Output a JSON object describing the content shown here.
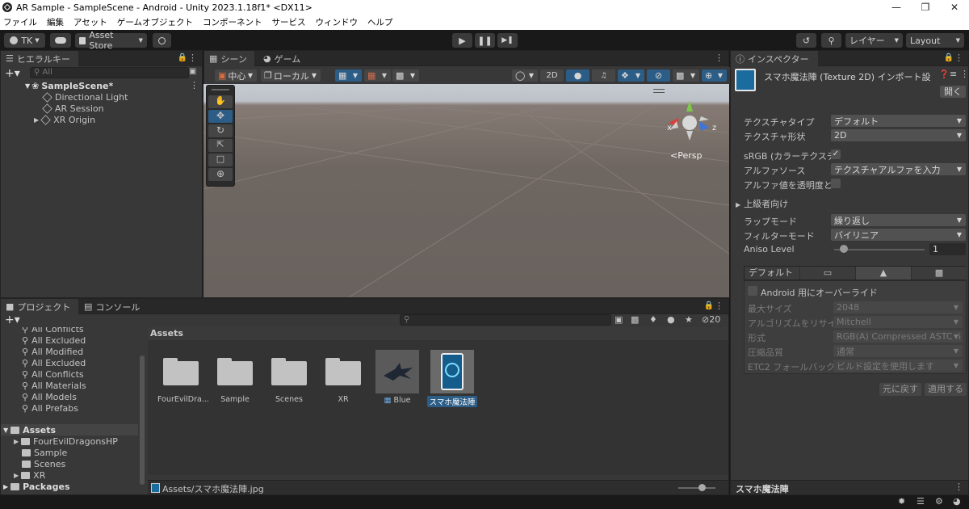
{
  "window": {
    "title": "AR Sample - SampleScene - Android - Unity 2023.1.18f1* <DX11>"
  },
  "menu": [
    "ファイル",
    "編集",
    "アセット",
    "ゲームオブジェクト",
    "コンポーネント",
    "サービス",
    "ウィンドウ",
    "ヘルプ"
  ],
  "toolbar": {
    "account": "TK",
    "asset_store": "Asset Store",
    "layers": "レイヤー",
    "layout": "Layout"
  },
  "hierarchy": {
    "tab": "ヒエラルキー",
    "search_placeholder": "All",
    "scene": "SampleScene*",
    "items": [
      "Directional Light",
      "AR Session",
      "XR Origin"
    ]
  },
  "scene_view": {
    "tabs": [
      "シーン",
      "ゲーム"
    ],
    "pivot": "中心",
    "space": "ローカル",
    "mode_2d": "2D",
    "persp": "Persp",
    "gizmo_labels": {
      "x": "x",
      "z": "z"
    }
  },
  "inspector": {
    "tab": "インスペクター",
    "header_title": "スマホ魔法陣 (Texture 2D) インポート設",
    "open_button": "開く",
    "fields": [
      {
        "label": "テクスチャタイプ",
        "value": "デフォルト"
      },
      {
        "label": "テクスチャ形状",
        "value": "2D"
      }
    ],
    "srgb_label": "sRGB (カラーテクスチ",
    "alpha_source_label": "アルファソース",
    "alpha_source_value": "テクスチャアルファを入力",
    "alpha_transparency_label": "アルファ値を透明度と",
    "advanced": "上級者向け",
    "wrap_label": "ラップモード",
    "wrap_value": "繰り返し",
    "filter_label": "フィルターモード",
    "filter_value": "バイリニア",
    "aniso_label": "Aniso Level",
    "aniso_value": "1",
    "aniso_level": 1,
    "platform_tab_default": "デフォルト",
    "override_label": "Android 用にオーバーライド",
    "platform_fields": [
      {
        "label": "最大サイズ",
        "value": "2048"
      },
      {
        "label": "アルゴリズムをリサイ",
        "value": "Mitchell"
      },
      {
        "label": "形式",
        "value": "RGB(A) Compressed ASTC 6"
      },
      {
        "label": "圧縮品質",
        "value": "通常"
      },
      {
        "label": "ETC2 フォールバック",
        "value": "ビルド設定を使用します"
      }
    ],
    "revert_button": "元に戻す",
    "apply_button": "適用する",
    "footer_title": "スマホ魔法陣"
  },
  "project": {
    "tabs": [
      "プロジェクト",
      "コンソール"
    ],
    "favorites": [
      "All Conflicts",
      "All Excluded",
      "All Modified",
      "All Excluded",
      "All Conflicts",
      "All Materials",
      "All Models",
      "All Prefabs"
    ],
    "tree_root": "Assets",
    "tree_children": [
      "FourEvilDragonsHP",
      "Sample",
      "Scenes",
      "XR"
    ],
    "packages": "Packages",
    "breadcrumb": "Assets",
    "hidden_count": "20",
    "assets": [
      {
        "name": "FourEvilDra...",
        "kind": "folder"
      },
      {
        "name": "Sample",
        "kind": "folder"
      },
      {
        "name": "Scenes",
        "kind": "folder"
      },
      {
        "name": "XR",
        "kind": "folder"
      },
      {
        "name": "Blue",
        "kind": "prefab"
      },
      {
        "name": "スマホ魔法陣",
        "kind": "texture"
      }
    ],
    "status_path": "Assets/スマホ魔法陣.jpg"
  },
  "colors": {
    "accent": "#2c5d87",
    "selection": "#2c5d87",
    "panel": "#383838"
  }
}
